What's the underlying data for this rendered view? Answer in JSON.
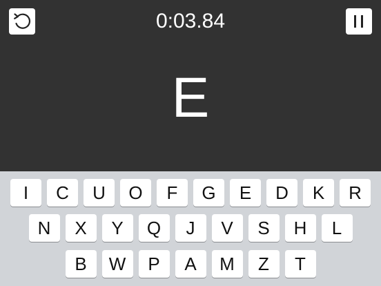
{
  "header": {
    "timer": "0:03.84",
    "restart_icon": "restart-icon",
    "pause_icon": "pause-icon"
  },
  "target_letter": "E",
  "keyboard": {
    "row1": [
      "I",
      "C",
      "U",
      "O",
      "F",
      "G",
      "E",
      "D",
      "K",
      "R"
    ],
    "row2": [
      "N",
      "X",
      "Y",
      "Q",
      "J",
      "V",
      "S",
      "H",
      "L"
    ],
    "row3": [
      "B",
      "W",
      "P",
      "A",
      "M",
      "Z",
      "T"
    ]
  },
  "colors": {
    "background": "#323232",
    "keyboard_background": "#d1d4d8",
    "key": "#ffffff",
    "text_light": "#ffffff"
  }
}
